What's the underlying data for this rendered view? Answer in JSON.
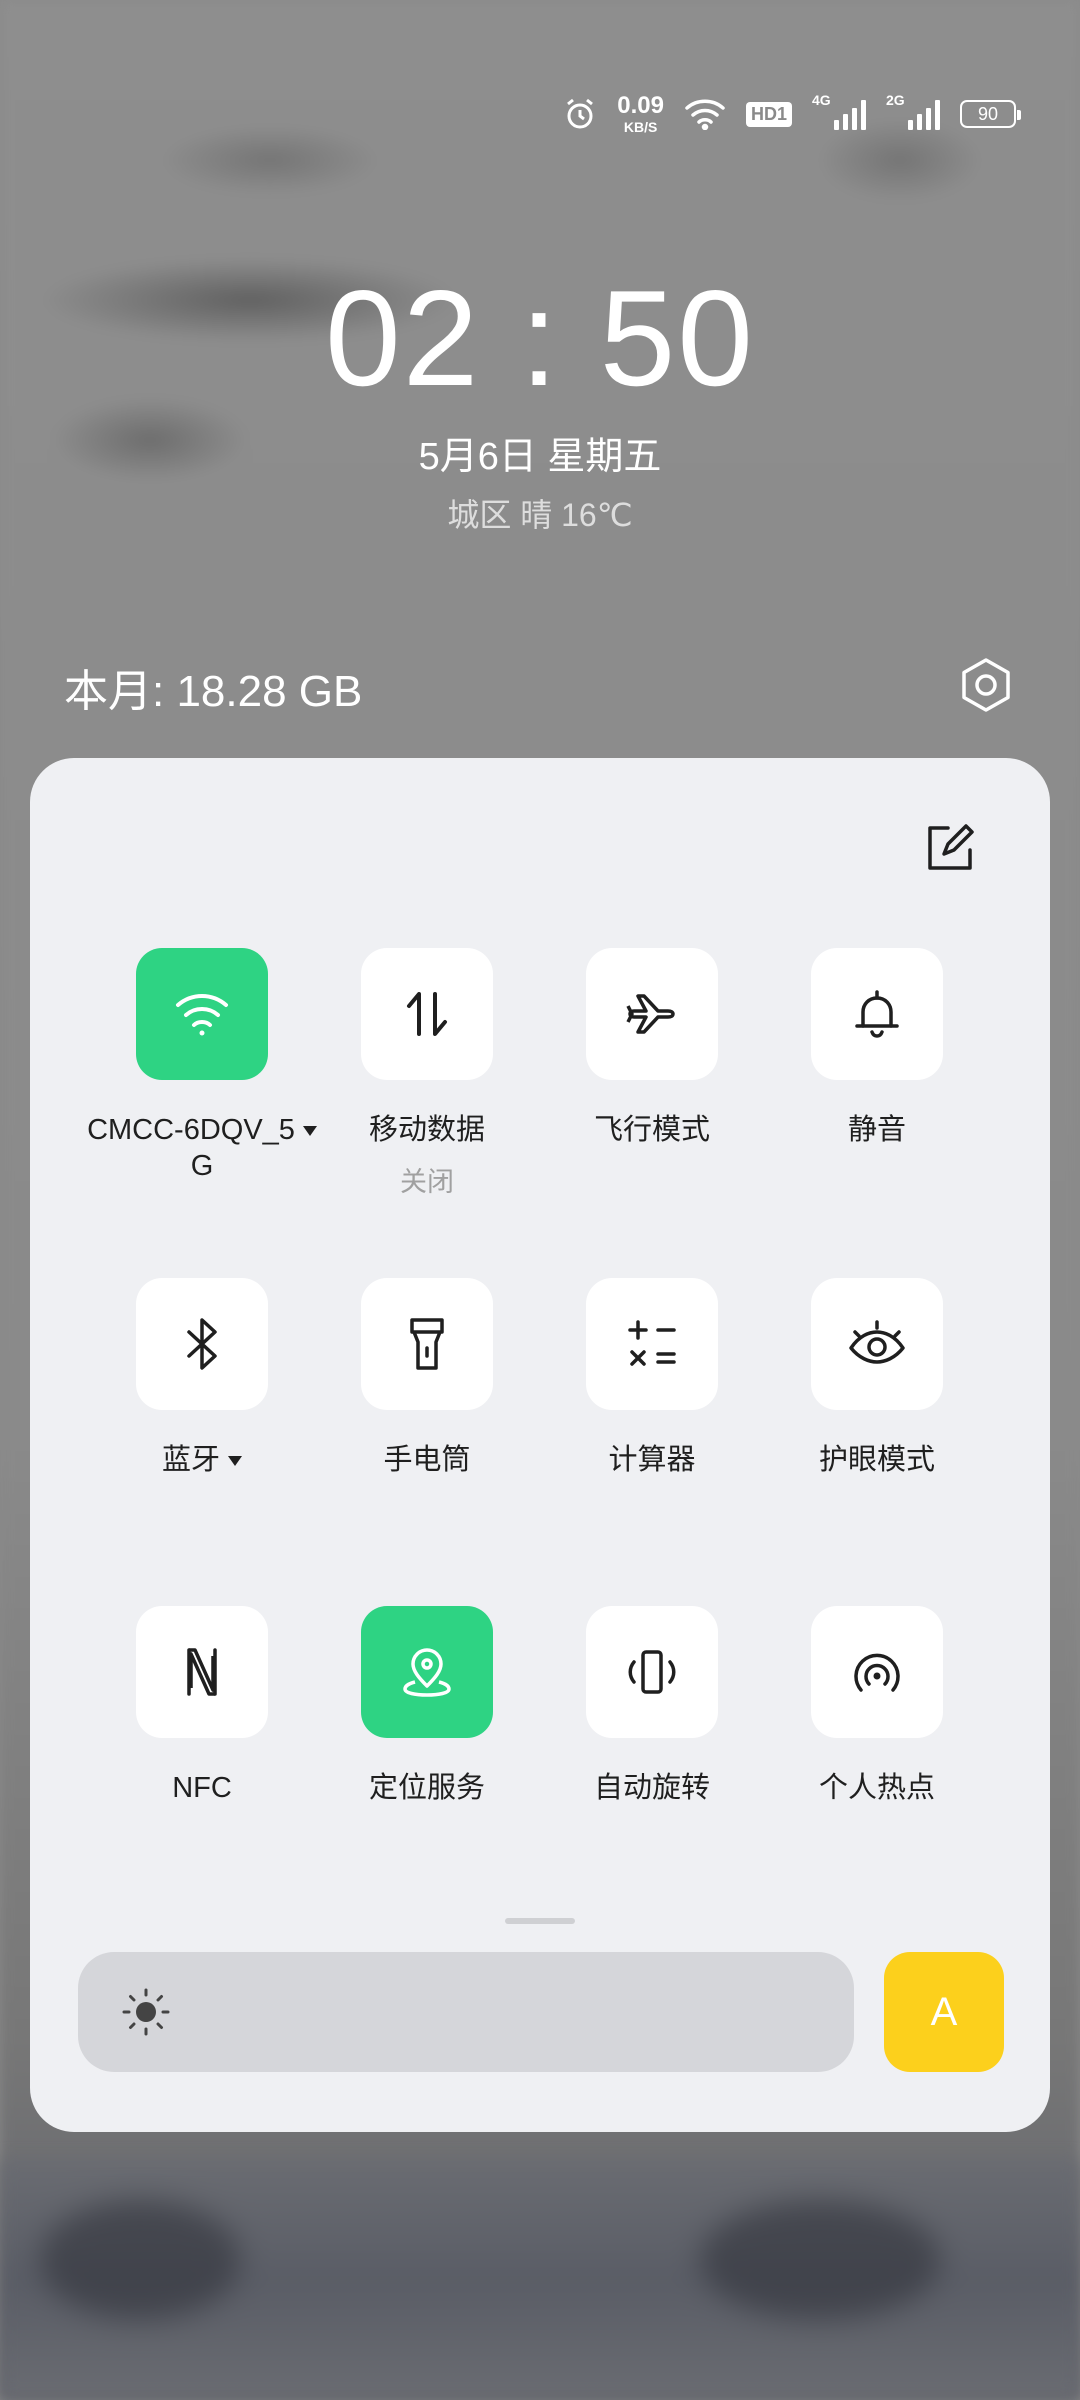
{
  "status_bar": {
    "net_speed_value": "0.09",
    "net_speed_unit": "KB/S",
    "hd_badge": "HD1",
    "sim1_type": "4G",
    "sim2_type": "2G",
    "battery": "90"
  },
  "lockscreen": {
    "time": "02 : 50",
    "date": "5月6日  星期五",
    "weather": "城区 晴 16℃",
    "data_usage": "本月: 18.28 GB"
  },
  "tiles": [
    {
      "label": "CMCC-6DQV_5",
      "label2": "G",
      "state": "on",
      "icon": "wifi-icon",
      "has_caret": true
    },
    {
      "label": "移动数据",
      "sub": "关闭",
      "state": "off",
      "icon": "mobile-data-icon"
    },
    {
      "label": "飞行模式",
      "state": "off",
      "icon": "airplane-icon"
    },
    {
      "label": "静音",
      "state": "off",
      "icon": "bell-icon"
    },
    {
      "label": "蓝牙",
      "state": "off",
      "icon": "bluetooth-icon",
      "has_caret": true
    },
    {
      "label": "手电筒",
      "state": "off",
      "icon": "flashlight-icon"
    },
    {
      "label": "计算器",
      "state": "off",
      "icon": "calculator-icon"
    },
    {
      "label": "护眼模式",
      "state": "off",
      "icon": "eye-icon"
    },
    {
      "label": "NFC",
      "state": "off",
      "icon": "nfc-icon"
    },
    {
      "label": "定位服务",
      "state": "on",
      "icon": "location-icon"
    },
    {
      "label": "自动旋转",
      "state": "off",
      "icon": "auto-rotate-icon"
    },
    {
      "label": "个人热点",
      "state": "off",
      "icon": "hotspot-icon"
    }
  ],
  "brightness": {
    "auto_label": "A",
    "level": 0.0
  },
  "colors": {
    "on": "#2ed383",
    "auto": "#fcd01c",
    "panel": "#eff0f3"
  }
}
